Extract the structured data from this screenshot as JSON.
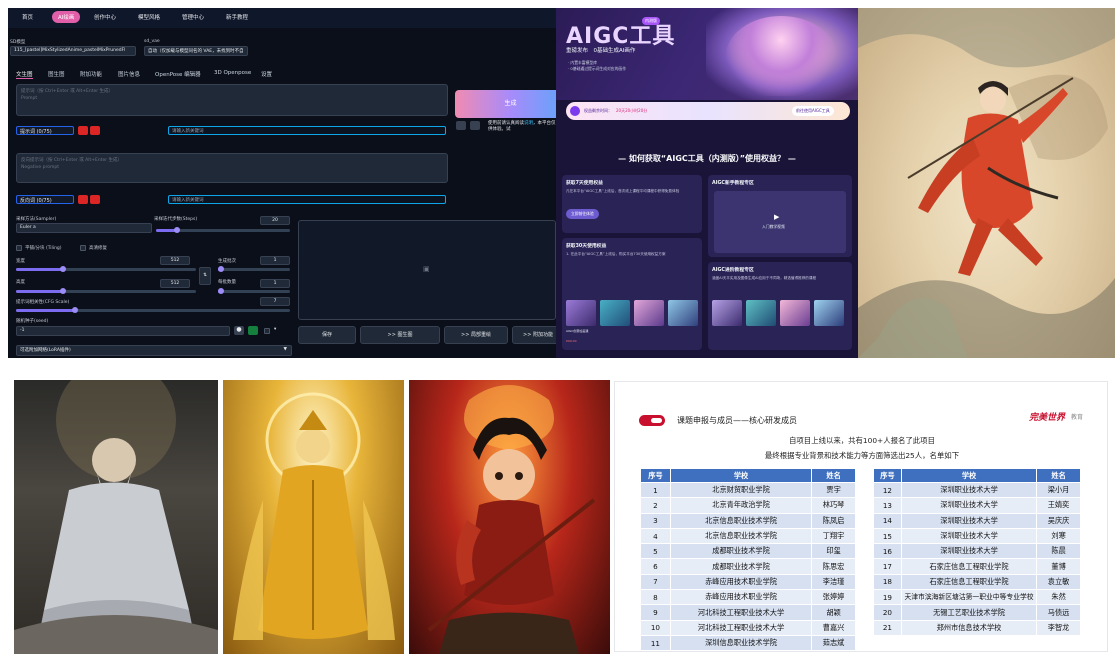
{
  "webui": {
    "top_tabs": [
      "首页",
      "AI绘画",
      "创作中心",
      "模型风格",
      "管理中心",
      "新手教程"
    ],
    "model_label": "SD模型",
    "model_value": "115_[pastel]MixStylizedAnime_pastelMixPrunedFl",
    "vae_label": "sd_vae",
    "vae_value": "自动（仅加载与模型同名的 VAE，未找到时不自",
    "sub_tabs": [
      "文生图",
      "图生图",
      "附加功能",
      "图片信息",
      "OpenPose 编辑器",
      "3D Openpose",
      "设置"
    ],
    "prompt_placeholder": "提示词（按 Ctrl+Enter 或 Alt+Enter 生成）",
    "prompt_placeholder_en": "Prompt",
    "prompt_chip": "提示词",
    "prompt_count": "(0/75)",
    "keyword_placeholder": "请输入新关键词",
    "neg_placeholder": "反向提示词（按 Ctrl+Enter 或 Alt+Enter 生成）",
    "neg_placeholder_en": "Negative prompt",
    "neg_chip": "反向词",
    "neg_count": "(0/75)",
    "generate": "生成",
    "notice_text": "使用前请认真阅读",
    "notice_text2": "，本平台仅供体验。试",
    "sampler_label": "采样方法(Sampler)",
    "sampler_value": "Euler a",
    "steps_label": "采样迭代步数(Steps)",
    "steps_value": "20",
    "tiling_label": "平铺/分块 (Tiling)",
    "hires_label": "高清修复",
    "width_label": "宽度",
    "width_value": "512",
    "height_label": "高度",
    "height_value": "512",
    "batch_count_label": "生成批次",
    "batch_count_value": "1",
    "batch_size_label": "每批数量",
    "batch_size_value": "1",
    "cfg_label": "提示词相关性(CFG Scale)",
    "cfg_value": "7",
    "seed_label": "随机种子(seed)",
    "seed_value": "-1",
    "lora_label": "可选附加网络(LoRA插件)",
    "save": "保存",
    "to_img2img": ">> 图生图",
    "to_inpaint": ">> 局部重绘",
    "to_extras": ">> 附加功能"
  },
  "aigc": {
    "title": "AIGC工具",
    "badge": "内测版",
    "subtitle": "重磅发布　0基础生成AI画作",
    "small1": "· 内置丰富模型库",
    "small2": "· 0基础通过提示词生成对应的画作",
    "bar_text": "权益剩余时间：",
    "bar_time": "20天20小时20分",
    "bar_btn": "前往使用AIGC工具",
    "question": "— 如何获取“AIGC工具（内测版）”使用权益？ —",
    "card1_title": "获取7天使用权益",
    "card1_text": "凡在本平台“AIGC工具”上线后，首次线上课程平均课程中获得免费体验",
    "card1_btn": "立即前往体验",
    "card2_title": "AIGC新手教程专区",
    "card2_video": "入门教学视频",
    "card3_title": "获取30天使用权益",
    "card3_text": "1. 在此平台“AIGC工具”上线后，购买平台730天使用权益方案",
    "card4_title": "AIGC进阶教程专区",
    "card4_text": "涵盖AI天平实用及图像生成AI应用于不同场，精选值得推荐的课程",
    "thumb_cap": "AIGC创意绘画课",
    "price": "¥99.00"
  },
  "slide": {
    "section_title": "课题申报与成员——核心研发成员",
    "logo": "完美世界",
    "logo_sub": "教育",
    "line1": "自项目上线以来，共有100+人报名了此项目",
    "line2": "最终根据专业背景和技术能力等方面筛选出25人，名单如下",
    "headers": [
      "序号",
      "学校",
      "姓名"
    ],
    "left_rows": [
      [
        "1",
        "北京财贸职业学院",
        "贾宇"
      ],
      [
        "2",
        "北京青年政治学院",
        "林巧琴"
      ],
      [
        "3",
        "北京信息职业技术学院",
        "陈凤启"
      ],
      [
        "4",
        "北京信息职业技术学院",
        "丁翔宇"
      ],
      [
        "5",
        "成都职业技术学院",
        "印玺"
      ],
      [
        "6",
        "成都职业技术学院",
        "陈思宏"
      ],
      [
        "7",
        "赤峰应用技术职业学院",
        "李洁瑾"
      ],
      [
        "8",
        "赤峰应用技术职业学院",
        "张婷婷"
      ],
      [
        "9",
        "河北科技工程职业技术大学",
        "胡颖"
      ],
      [
        "10",
        "河北科技工程职业技术大学",
        "曹嘉兴"
      ],
      [
        "11",
        "深圳信息职业技术学院",
        "茹志斌"
      ]
    ],
    "right_rows": [
      [
        "12",
        "深圳职业技术大学",
        "梁小月"
      ],
      [
        "13",
        "深圳职业技术大学",
        "王婧奕"
      ],
      [
        "14",
        "深圳职业技术大学",
        "吴庆庆"
      ],
      [
        "15",
        "深圳职业技术大学",
        "刘寒"
      ],
      [
        "16",
        "深圳职业技术大学",
        "陈晨"
      ],
      [
        "17",
        "石家庄信息工程职业学院",
        "董博"
      ],
      [
        "18",
        "石家庄信息工程职业学院",
        "袁立敏"
      ],
      [
        "19",
        "天津市滨海新区塘沽第一职业中等专业学校",
        "朱然"
      ],
      [
        "20",
        "无锡工艺职业技术学院",
        "马债远"
      ],
      [
        "21",
        "郑州市信息技术学校",
        "李智龙"
      ]
    ]
  },
  "colors": {
    "webui_bg": "#0b0f19",
    "accent_pink": "#e15fa8",
    "table_header": "#3f6fbf",
    "brand_red": "#c8102e"
  }
}
